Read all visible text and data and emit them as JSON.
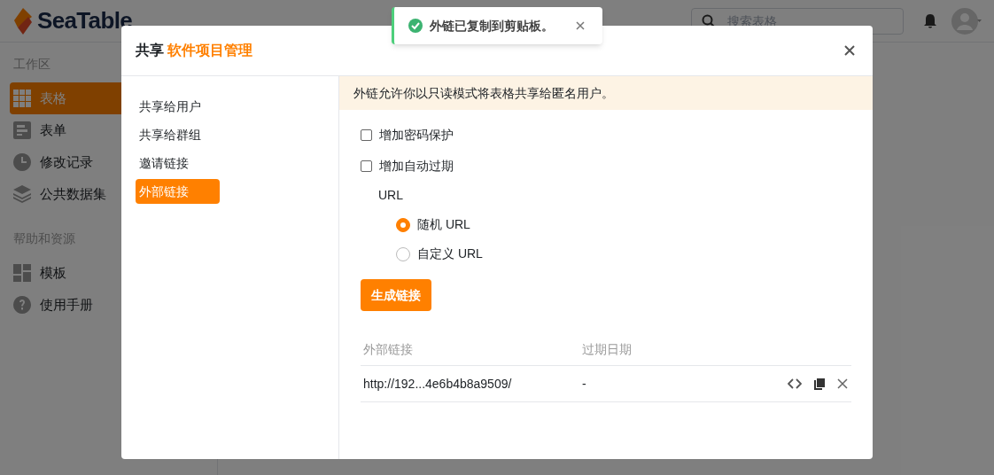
{
  "app": {
    "logo": "SeaTable",
    "search": {
      "placeholder": "搜索表格"
    },
    "sidebar": {
      "sections": [
        {
          "title": "工作区",
          "items": [
            {
              "label": "表格",
              "kind": "grid",
              "selected": true
            },
            {
              "label": "表单",
              "kind": "form",
              "selected": false
            },
            {
              "label": "修改记录",
              "kind": "clock",
              "selected": false
            },
            {
              "label": "公共数据集",
              "kind": "layers",
              "selected": false
            }
          ]
        },
        {
          "title": "帮助和资源",
          "items": [
            {
              "label": "模板",
              "kind": "tiles",
              "selected": false
            },
            {
              "label": "使用手册",
              "kind": "help",
              "selected": false
            }
          ]
        }
      ]
    }
  },
  "toast": {
    "message": "外链已复制到剪贴板。"
  },
  "dialog": {
    "title": "共享",
    "subject": "软件项目管理",
    "nav": [
      {
        "label": "共享给用户",
        "selected": false
      },
      {
        "label": "共享给群组",
        "selected": false
      },
      {
        "label": "邀请链接",
        "selected": false
      },
      {
        "label": "外部链接",
        "selected": true
      }
    ],
    "notice": "外链允许你以只读模式将表格共享给匿名用户。",
    "options": [
      {
        "label": "增加密码保护",
        "checked": false
      },
      {
        "label": "增加自动过期",
        "checked": false
      }
    ],
    "url_label": "URL",
    "url_choices": [
      {
        "label": "随机 URL",
        "selected": true
      },
      {
        "label": "自定义 URL",
        "selected": false
      }
    ],
    "generate_button": "生成链接",
    "table": {
      "columns": [
        "外部链接",
        "过期日期"
      ],
      "rows": [
        {
          "link": "http://192...4e6b4b8a9509/",
          "expiry": "-"
        }
      ]
    }
  }
}
